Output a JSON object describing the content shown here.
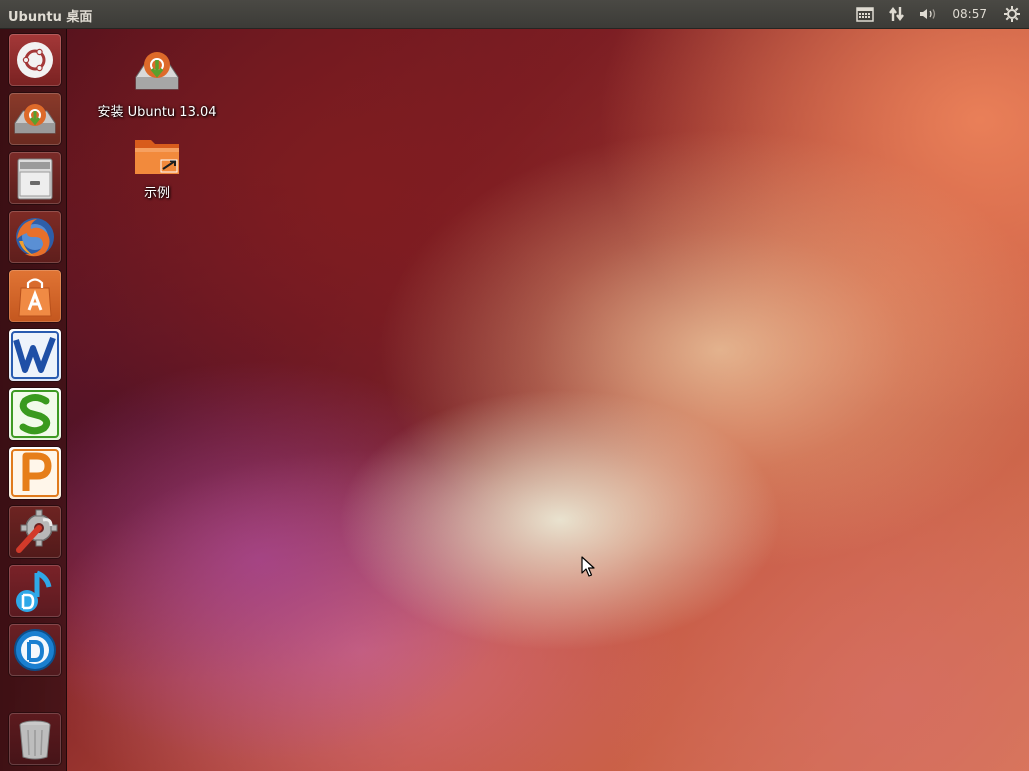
{
  "panel": {
    "title": "Ubuntu 桌面",
    "clock": "08:57",
    "indicators": [
      "calendar-icon",
      "network-icon",
      "volume-icon",
      "clock",
      "session-gear-icon"
    ]
  },
  "launcher": {
    "items": [
      {
        "name": "dash-home",
        "icon": "ubuntu-logo-icon"
      },
      {
        "name": "install-ubuntu",
        "icon": "installer-icon"
      },
      {
        "name": "files",
        "icon": "file-cabinet-icon"
      },
      {
        "name": "firefox",
        "icon": "firefox-icon"
      },
      {
        "name": "software-center",
        "icon": "shopping-bag-icon"
      },
      {
        "name": "wps-writer",
        "icon": "w-writer-icon"
      },
      {
        "name": "wps-spreadsheets",
        "icon": "s-spreadsheet-icon"
      },
      {
        "name": "wps-presentation",
        "icon": "p-presentation-icon"
      },
      {
        "name": "system-settings",
        "icon": "wrench-gear-icon"
      },
      {
        "name": "music-player",
        "icon": "music-note-icon"
      },
      {
        "name": "media-app",
        "icon": "round-d-logo-icon"
      },
      {
        "name": "trash",
        "icon": "trash-icon"
      }
    ]
  },
  "desktop": {
    "icons": [
      {
        "label": "安装 Ubuntu 13.04",
        "icon": "installer-icon"
      },
      {
        "label": "示例",
        "icon": "folder-link-icon"
      }
    ]
  },
  "colors": {
    "panel_bg": "#3c3b37",
    "panel_text": "#dfdbd2",
    "launcher_bg": "#3a0f14",
    "wallpaper_accent": "#dd4814"
  }
}
